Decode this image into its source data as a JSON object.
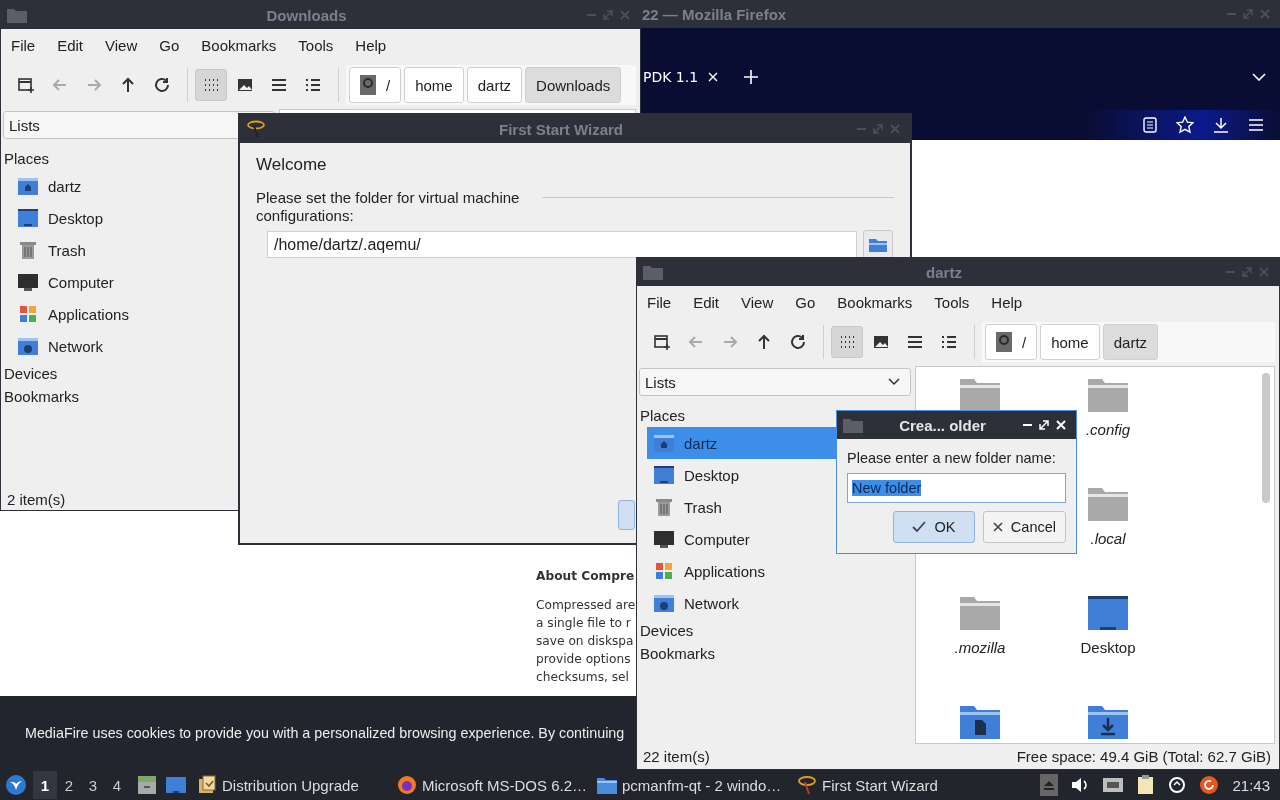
{
  "firefox": {
    "title": "22 — Mozilla Firefox",
    "tab": {
      "label": "PDK 1.1"
    },
    "page": {
      "heading": "About Compre",
      "lines": [
        "Compressed are",
        "a single file to r",
        "save on diskspa",
        "provide options",
        "checksums, sel"
      ]
    },
    "cookie_banner": "MediaFire uses cookies to provide you with a personalized browsing experience. By continuing"
  },
  "downloads_window": {
    "title": "Downloads",
    "menu": [
      "File",
      "Edit",
      "View",
      "Go",
      "Bookmarks",
      "Tools",
      "Help"
    ],
    "toolbar": [
      {
        "kind": "new-window",
        "disabled": false
      },
      {
        "kind": "back",
        "disabled": true
      },
      {
        "kind": "forward",
        "disabled": true
      },
      {
        "kind": "up",
        "disabled": false
      },
      {
        "kind": "reload",
        "disabled": false
      }
    ],
    "view_modes": [
      {
        "kind": "icons",
        "selected": true
      },
      {
        "kind": "thumbnails",
        "selected": false
      },
      {
        "kind": "compact",
        "selected": false
      },
      {
        "kind": "details",
        "selected": false
      }
    ],
    "path": [
      {
        "kind": "root",
        "label": "/",
        "selected": false
      },
      {
        "kind": "folder",
        "label": "home",
        "selected": false
      },
      {
        "kind": "folder",
        "label": "dartz",
        "selected": false
      },
      {
        "kind": "folder",
        "label": "Downloads",
        "selected": true
      }
    ],
    "sidebar": {
      "dropdown": "Lists",
      "sections": [
        {
          "label": "Places",
          "items": [
            {
              "kind": "home",
              "label": "dartz",
              "selected": false
            },
            {
              "kind": "desktop",
              "label": "Desktop",
              "selected": false
            },
            {
              "kind": "trash",
              "label": "Trash",
              "selected": false
            },
            {
              "kind": "computer",
              "label": "Computer",
              "selected": false
            },
            {
              "kind": "applications",
              "label": "Applications",
              "selected": false
            },
            {
              "kind": "network",
              "label": "Network",
              "selected": false
            }
          ]
        },
        {
          "label": "Devices"
        },
        {
          "label": "Bookmarks"
        }
      ]
    },
    "status": "2 item(s)"
  },
  "wizard": {
    "title": "First Start Wizard",
    "heading": "Welcome",
    "label": "Please set the folder for virtual machine configurations:",
    "folder": "/home/dartz/.aqemu/"
  },
  "dartz_window": {
    "title": "dartz",
    "menu": [
      "File",
      "Edit",
      "View",
      "Go",
      "Bookmarks",
      "Tools",
      "Help"
    ],
    "toolbar": [
      {
        "kind": "new-window",
        "disabled": false
      },
      {
        "kind": "back",
        "disabled": true
      },
      {
        "kind": "forward",
        "disabled": true
      },
      {
        "kind": "up",
        "disabled": false
      },
      {
        "kind": "reload",
        "disabled": false
      }
    ],
    "view_modes": [
      {
        "kind": "icons",
        "selected": true
      },
      {
        "kind": "thumbnails",
        "selected": false
      },
      {
        "kind": "compact",
        "selected": false
      },
      {
        "kind": "details",
        "selected": false
      }
    ],
    "path": [
      {
        "kind": "root",
        "label": "/",
        "selected": false
      },
      {
        "kind": "folder",
        "label": "home",
        "selected": false
      },
      {
        "kind": "folder",
        "label": "dartz",
        "selected": true
      }
    ],
    "sidebar": {
      "dropdown": "Lists",
      "sections": [
        {
          "label": "Places",
          "items": [
            {
              "kind": "home",
              "label": "dartz",
              "selected": true
            },
            {
              "kind": "desktop",
              "label": "Desktop",
              "selected": false
            },
            {
              "kind": "trash",
              "label": "Trash",
              "selected": false
            },
            {
              "kind": "computer",
              "label": "Computer",
              "selected": false
            },
            {
              "kind": "applications",
              "label": "Applications",
              "selected": false
            },
            {
              "kind": "network",
              "label": "Network",
              "selected": false
            }
          ]
        },
        {
          "label": "Devices"
        },
        {
          "label": "Bookmarks"
        }
      ]
    },
    "file_rows": [
      [
        {
          "kind": "plain"
        },
        {
          "kind": "plain",
          "label": ".config",
          "hidden": true
        }
      ],
      [
        {
          "kind": "plain",
          "label": ".local",
          "hidden": true
        }
      ],
      [
        {
          "kind": "plain",
          "label": ".mozilla",
          "hidden": true
        },
        {
          "kind": "desktop",
          "label": "Desktop",
          "hidden": false
        }
      ],
      [
        {
          "kind": "documents"
        },
        {
          "kind": "downloads"
        }
      ]
    ],
    "status": "22 item(s)",
    "free_space": "Free space: 49.4 GiB (Total: 62.7 GiB)"
  },
  "dialog": {
    "title": "Crea... older",
    "prompt": "Please enter a new folder name:",
    "value": "New folder",
    "buttons": [
      {
        "kind": "ok",
        "label": "OK",
        "default": true
      },
      {
        "kind": "cancel",
        "label": "Cancel",
        "default": false
      }
    ]
  },
  "taskbar": {
    "workspaces": [
      {
        "label": "1",
        "selected": true
      },
      {
        "label": "2",
        "selected": false
      },
      {
        "label": "3",
        "selected": false
      },
      {
        "label": "4",
        "selected": false
      }
    ],
    "tasks": [
      {
        "kind": "upgrade",
        "label": "Distribution Upgrade"
      },
      {
        "kind": "firefox",
        "label": "Microsoft MS-DOS 6.2…"
      },
      {
        "kind": "folder",
        "label": "pcmanfm-qt - 2 windo…"
      },
      {
        "kind": "wizard",
        "label": "First Start Wizard"
      }
    ],
    "clock": "21:43"
  }
}
